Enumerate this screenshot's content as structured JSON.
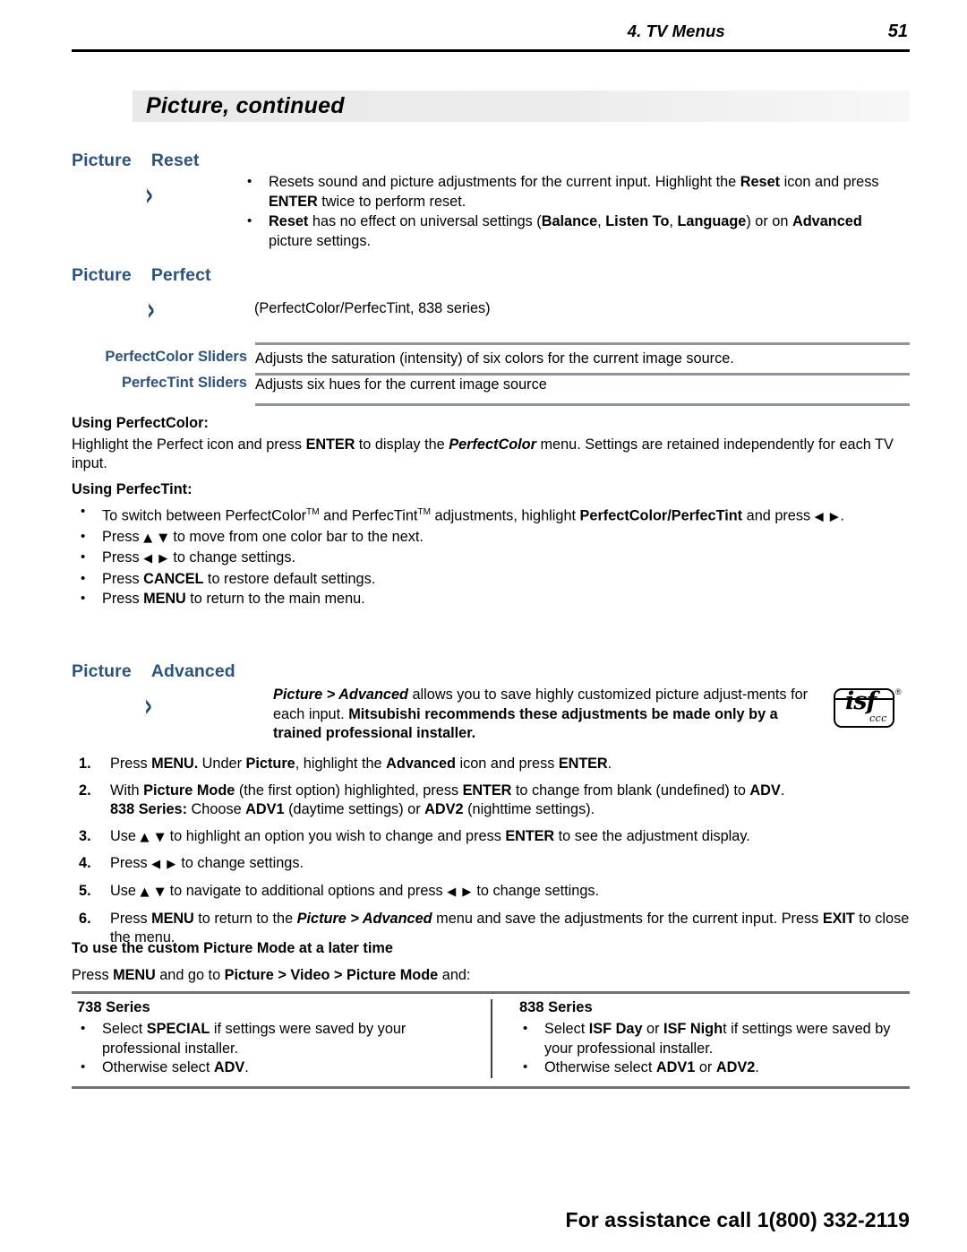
{
  "header": {
    "chapter": "4.  TV Menus",
    "page_number": "51"
  },
  "title_bar": {
    "title": "Picture, continued"
  },
  "reset_section": {
    "crumb1": "Picture",
    "crumb2": "Reset",
    "chevron": "›",
    "bullets": [
      {
        "parts": [
          {
            "t": "Resets sound and picture adjustments for the current input.  Highlight the ",
            "s": "n"
          },
          {
            "t": "Reset",
            "s": "b"
          },
          {
            "t": " icon and press ",
            "s": "n"
          },
          {
            "t": "ENTER",
            "s": "k"
          },
          {
            "t": " twice to perform reset.",
            "s": "n"
          }
        ]
      },
      {
        "parts": [
          {
            "t": "Reset",
            "s": "b"
          },
          {
            "t": " has no effect on universal settings (",
            "s": "n"
          },
          {
            "t": "Balance",
            "s": "b"
          },
          {
            "t": ", ",
            "s": "n"
          },
          {
            "t": "Listen To",
            "s": "b"
          },
          {
            "t": ", ",
            "s": "n"
          },
          {
            "t": "Language",
            "s": "b"
          },
          {
            "t": ") or on ",
            "s": "n"
          },
          {
            "t": "Advanced",
            "s": "b"
          },
          {
            "t": " picture settings.",
            "s": "n"
          }
        ]
      }
    ]
  },
  "perfect_section": {
    "crumb1": "Picture",
    "crumb2": "Perfect",
    "chevron": "›",
    "note": "(PerfectColor/PerfecTint, 838 series)"
  },
  "slider_table": {
    "rows": [
      {
        "label": "PerfectColor Sliders",
        "desc": "Adjusts the saturation (intensity) of six colors for the current image source."
      },
      {
        "label": "PerfecTint Sliders",
        "desc": "Adjusts six hues for the current image source"
      }
    ]
  },
  "using_perfectcolor": {
    "heading": "Using PerfectColor:",
    "paragraph": [
      {
        "t": "Highlight the Perfect icon and press ",
        "s": "n"
      },
      {
        "t": "ENTER",
        "s": "k"
      },
      {
        "t": " to display the ",
        "s": "n"
      },
      {
        "t": "PerfectColor",
        "s": "bi"
      },
      {
        "t": " menu.  Settings are retained independently for each TV input.",
        "s": "n"
      }
    ]
  },
  "using_perfectint": {
    "heading": "Using PerfecTint:",
    "bullets": [
      {
        "parts": [
          {
            "t": "To switch between PerfectColor",
            "s": "n"
          },
          {
            "t": "TM",
            "s": "sup"
          },
          {
            "t": " and PerfecTint",
            "s": "n"
          },
          {
            "t": "TM",
            "s": "sup"
          },
          {
            "t": " adjustments, highlight ",
            "s": "n"
          },
          {
            "t": "PerfectColor/PerfecTint",
            "s": "b"
          },
          {
            "t": " and press ",
            "s": "n"
          },
          {
            "t": "◀ ▶",
            "s": "arw"
          },
          {
            "t": ".",
            "s": "n"
          }
        ]
      },
      {
        "parts": [
          {
            "t": "Press ",
            "s": "n"
          },
          {
            "t": "▲ ▼",
            "s": "arw"
          },
          {
            "t": " to move from one color bar to the next.",
            "s": "n"
          }
        ]
      },
      {
        "parts": [
          {
            "t": "Press ",
            "s": "n"
          },
          {
            "t": "◀ ▶",
            "s": "arw"
          },
          {
            "t": " to change settings.",
            "s": "n"
          }
        ]
      },
      {
        "parts": [
          {
            "t": "Press ",
            "s": "n"
          },
          {
            "t": "CANCEL",
            "s": "k"
          },
          {
            "t": " to restore default settings.",
            "s": "n"
          }
        ]
      },
      {
        "parts": [
          {
            "t": "Press ",
            "s": "n"
          },
          {
            "t": "MENU",
            "s": "k"
          },
          {
            "t": " to return to the main menu.",
            "s": "n"
          }
        ]
      }
    ]
  },
  "advanced_section": {
    "crumb1": "Picture",
    "crumb2": "Advanced",
    "chevron": "›",
    "intro": [
      {
        "t": "Picture > Advanced",
        "s": "bi"
      },
      {
        "t": " allows you to save highly customized picture adjust-ments for each input.  ",
        "s": "n"
      },
      {
        "t": "Mitsubishi recommends these adjustments be made only by a trained professional installer.",
        "s": "b"
      }
    ],
    "badge": {
      "mark": "isf",
      "sub": "ccc",
      "registered": "®"
    },
    "steps": [
      [
        {
          "t": "Press ",
          "s": "n"
        },
        {
          "t": "MENU.",
          "s": "k"
        },
        {
          "t": "  Under ",
          "s": "n"
        },
        {
          "t": "Picture",
          "s": "b"
        },
        {
          "t": ", highlight the ",
          "s": "n"
        },
        {
          "t": "Advanced",
          "s": "b"
        },
        {
          "t": " icon and press ",
          "s": "n"
        },
        {
          "t": "ENTER",
          "s": "k"
        },
        {
          "t": ".",
          "s": "n"
        }
      ],
      [
        {
          "t": "With ",
          "s": "n"
        },
        {
          "t": "Picture Mode",
          "s": "b"
        },
        {
          "t": " (the first option) highlighted, press ",
          "s": "n"
        },
        {
          "t": "ENTER",
          "s": "k"
        },
        {
          "t": " to change from blank (undefined) to ",
          "s": "n"
        },
        {
          "t": "ADV",
          "s": "b"
        },
        {
          "t": ".",
          "s": "n"
        },
        {
          "t": "\n",
          "s": "br"
        },
        {
          "t": "838 Series:",
          "s": "b"
        },
        {
          "t": "  Choose ",
          "s": "n"
        },
        {
          "t": "ADV1",
          "s": "b"
        },
        {
          "t": " (daytime settings) or ",
          "s": "n"
        },
        {
          "t": "ADV2",
          "s": "b"
        },
        {
          "t": " (nighttime settings).",
          "s": "n"
        }
      ],
      [
        {
          "t": "Use ",
          "s": "n"
        },
        {
          "t": "▲ ▼",
          "s": "arw"
        },
        {
          "t": " to highlight an option you wish to change and press ",
          "s": "n"
        },
        {
          "t": "ENTER",
          "s": "k"
        },
        {
          "t": " to see the adjustment display.",
          "s": "n"
        }
      ],
      [
        {
          "t": "Press ",
          "s": "n"
        },
        {
          "t": "◀ ▶",
          "s": "arw"
        },
        {
          "t": " to change settings.",
          "s": "n"
        }
      ],
      [
        {
          "t": "Use ",
          "s": "n"
        },
        {
          "t": "▲ ▼",
          "s": "arw"
        },
        {
          "t": " to navigate to additional options and press ",
          "s": "n"
        },
        {
          "t": "◀ ▶",
          "s": "arw"
        },
        {
          "t": " to change settings.",
          "s": "n"
        }
      ],
      [
        {
          "t": "Press ",
          "s": "n"
        },
        {
          "t": "MENU",
          "s": "k"
        },
        {
          "t": " to return to the ",
          "s": "n"
        },
        {
          "t": "Picture > Advanced",
          "s": "bi"
        },
        {
          "t": " menu and save the adjustments for the current input.  Press ",
          "s": "n"
        },
        {
          "t": "EXIT",
          "s": "k"
        },
        {
          "t": " to close the menu.",
          "s": "n"
        }
      ]
    ]
  },
  "custom_mode": {
    "heading": "To use the custom Picture Mode at a later time",
    "instruction": [
      {
        "t": "Press ",
        "s": "n"
      },
      {
        "t": "MENU",
        "s": "k"
      },
      {
        "t": " and go to ",
        "s": "n"
      },
      {
        "t": "Picture > Video > Picture Mode",
        "s": "b"
      },
      {
        "t": " and:",
        "s": "n"
      }
    ],
    "columns": [
      {
        "heading": "738 Series",
        "bullets": [
          [
            {
              "t": "Select ",
              "s": "n"
            },
            {
              "t": "SPECIAL",
              "s": "b"
            },
            {
              "t": " if settings were saved by your professional installer.",
              "s": "n"
            }
          ],
          [
            {
              "t": "Otherwise select ",
              "s": "n"
            },
            {
              "t": "ADV",
              "s": "b"
            },
            {
              "t": ".",
              "s": "n"
            }
          ]
        ]
      },
      {
        "heading": "838 Series",
        "bullets": [
          [
            {
              "t": "Select ",
              "s": "n"
            },
            {
              "t": "ISF Day",
              "s": "b"
            },
            {
              "t": " or ",
              "s": "n"
            },
            {
              "t": "ISF Nigh",
              "s": "b"
            },
            {
              "t": "t if settings were saved by your professional installer.",
              "s": "n"
            }
          ],
          [
            {
              "t": "Otherwise select ",
              "s": "n"
            },
            {
              "t": "ADV1",
              "s": "b"
            },
            {
              "t": " or ",
              "s": "n"
            },
            {
              "t": "ADV2",
              "s": "b"
            },
            {
              "t": ".",
              "s": "n"
            }
          ]
        ]
      }
    ]
  },
  "footer": {
    "text": "For assistance call 1(800) 332-2119"
  },
  "colors": {
    "heading_blue": "#2a5382",
    "rule_gray": "#8e9499",
    "table_rule": "#6f7276"
  }
}
